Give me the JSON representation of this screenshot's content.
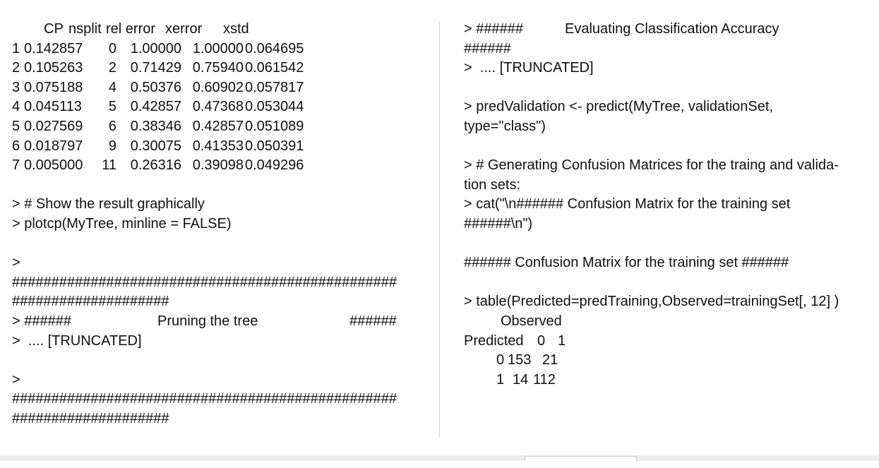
{
  "left": {
    "cp_header": {
      "cp": "CP",
      "nsplit": "nsplit",
      "rel": "rel error",
      "xerror": "xerror",
      "xstd": "xstd"
    },
    "cp_rows": [
      {
        "idx": "1",
        "cp": "0.142857",
        "nsplit": "0",
        "rel": "1.00000",
        "xerror": "1.00000",
        "xstd": "0.064695"
      },
      {
        "idx": "2",
        "cp": "0.105263",
        "nsplit": "2",
        "rel": "0.71429",
        "xerror": "0.75940",
        "xstd": "0.061542"
      },
      {
        "idx": "3",
        "cp": "0.075188",
        "nsplit": "4",
        "rel": "0.50376",
        "xerror": "0.60902",
        "xstd": "0.057817"
      },
      {
        "idx": "4",
        "cp": "0.045113",
        "nsplit": "5",
        "rel": "0.42857",
        "xerror": "0.47368",
        "xstd": "0.053044"
      },
      {
        "idx": "5",
        "cp": "0.027569",
        "nsplit": "6",
        "rel": "0.38346",
        "xerror": "0.42857",
        "xstd": "0.051089"
      },
      {
        "idx": "6",
        "cp": "0.018797",
        "nsplit": "9",
        "rel": "0.30075",
        "xerror": "0.41353",
        "xstd": "0.050391"
      },
      {
        "idx": "7",
        "cp": "0.005000",
        "nsplit": "11",
        "rel": "0.26316",
        "xerror": "0.39098",
        "xstd": "0.049296"
      }
    ],
    "comment_graph": "> # Show the result graphically",
    "plotcp_cmd": "> plotcp(MyTree, minline = FALSE)",
    "prompt_1": ">",
    "hash_line_1a": "#################################################",
    "hash_line_1b": "####################",
    "pruning_prefix": "> ######",
    "pruning_title": "Pruning the tree",
    "pruning_suffix": "######",
    "truncated_1": ">  .... [TRUNCATED]",
    "prompt_2": ">",
    "hash_line_2a": "#################################################",
    "hash_line_2b": "####################"
  },
  "right": {
    "eval_prefix": "> ######",
    "eval_title": "Evaluating Classification Accuracy",
    "eval_suffix": "######",
    "truncated_1": ">  .... [TRUNCATED]",
    "pred_line_1": "> predValidation <- predict(MyTree, validationSet,",
    "pred_line_2": "type=\"class\")",
    "comment_line_1": "> # Generating Confusion Matrices for the traing and valida-",
    "comment_line_2": "tion sets:",
    "cat_line_1": "> cat(\"\\n###### Confusion Matrix for the training set",
    "cat_line_2": "######\\n\")",
    "cm_title": "###### Confusion Matrix for the training set ######",
    "table_cmd": "> table(Predicted=predTraining,Observed=trainingSet[, 12] )",
    "observed_label": "Observed",
    "predicted_label": "Predicted",
    "col_0": "0",
    "col_1": "1",
    "row0": {
      "label": "0",
      "v0": "153",
      "v1": "21"
    },
    "row1": {
      "label": "1",
      "v0": "14",
      "v1": "112"
    }
  }
}
